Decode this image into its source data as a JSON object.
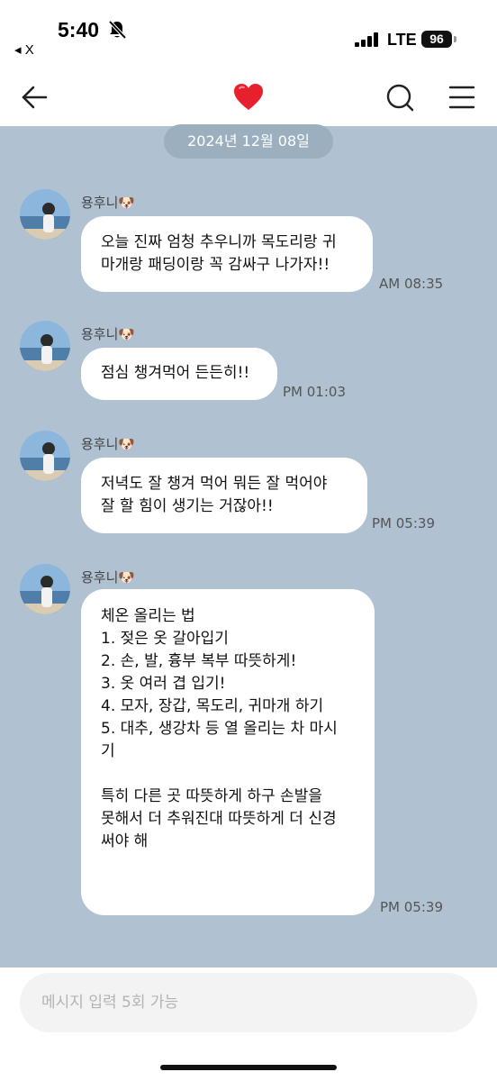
{
  "status_bar": {
    "time": "5:40",
    "back_app": "◂ X",
    "carrier": "LTE",
    "battery": "96"
  },
  "header": {
    "back_icon": "arrow-left-icon",
    "title_icon": "red-heart-icon",
    "search_icon": "search-icon",
    "menu_icon": "hamburger-menu-icon"
  },
  "chat": {
    "date": "2024년 12월 08일",
    "messages": [
      {
        "sender": "용후니🐶",
        "text": "오늘 진짜 엄청 추우니까 목도리랑 귀\n마개랑 패딩이랑 꼭 감싸구 나가자!!",
        "time": "AM 08:35"
      },
      {
        "sender": "용후니🐶",
        "text": "점심 챙겨먹어 든든히!!",
        "time": "PM 01:03"
      },
      {
        "sender": "용후니🐶",
        "text": "저녁도 잘 챙겨 먹어 뭐든 잘 먹어야\n잘 할 힘이 생기는 거잖아!!",
        "time": "PM 05:39"
      },
      {
        "sender": "용후니🐶",
        "text": "체온 올리는 법\n1. 젖은 옷 갈아입기\n2. 손, 발, 흉부 복부 따뜻하게!\n3. 옷 여러 겹 입기!\n4. 모자, 장갑, 목도리, 귀마개 하기\n5. 대추, 생강차 등 열 올리는 차 마시\n기\n\n특히 다른 곳 따뜻하게 하구 손발을\n못해서 더 추워진대 따뜻하게 더 신경\n써야 해",
        "time": "PM 05:39"
      }
    ]
  },
  "input": {
    "placeholder": "메시지 입력 5회 가능"
  }
}
